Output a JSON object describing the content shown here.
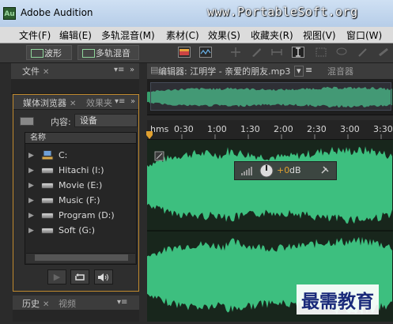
{
  "window": {
    "title": "Adobe Audition",
    "app_icon": "Au",
    "watermark_url": "www.PortableSoft.org"
  },
  "menu": [
    "文件(F)",
    "编辑(E)",
    "多轨混音(M)",
    "素材(C)",
    "效果(S)",
    "收藏夹(R)",
    "视图(V)",
    "窗口(W)"
  ],
  "toolbar": {
    "waveform_label": "波形",
    "multitrack_label": "多轨混音"
  },
  "files_panel": {
    "tab": "文件"
  },
  "media_browser": {
    "tab_active": "媒体浏览器",
    "tab_other": "效果夹",
    "content_label": "内容:",
    "content_value": "设备",
    "column_name": "名称",
    "items": [
      {
        "label": "C:",
        "icon": "computer-icon"
      },
      {
        "label": "Hitachi (I:)",
        "icon": "drive-icon"
      },
      {
        "label": "Movie (E:)",
        "icon": "drive-icon"
      },
      {
        "label": "Music (F:)",
        "icon": "drive-icon"
      },
      {
        "label": "Program (D:)",
        "icon": "drive-icon"
      },
      {
        "label": "Soft (G:)",
        "icon": "drive-icon"
      }
    ]
  },
  "history_panel": {
    "tab_history": "历史",
    "tab_video": "视频"
  },
  "editor": {
    "tab_label": "编辑器: 江明学 - 亲爱的朋友.mp3",
    "mixer_tab": "混音器",
    "time_units": "hms",
    "ticks": [
      "0:30",
      "1:00",
      "1:30",
      "2:00",
      "2:30",
      "3:00",
      "3:30"
    ],
    "hud_value": "+0",
    "hud_unit": "dB"
  },
  "colors": {
    "waveform": "#3dbf7f",
    "accent_orange": "#e0a030",
    "selection_outline": "#c08a2e"
  },
  "watermark_bottom": "最需教育"
}
